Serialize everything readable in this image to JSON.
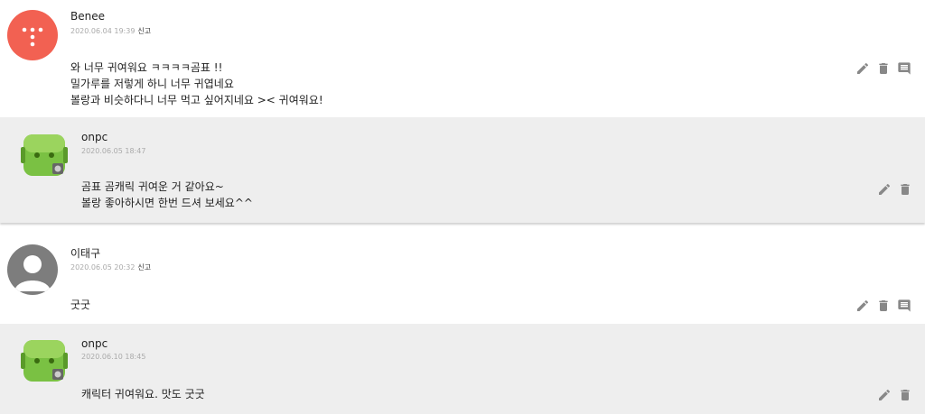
{
  "comments": [
    {
      "author": "Benee",
      "date": "2020.06.04 19:39",
      "report": "신고",
      "lines": [
        "와 너무 귀여워요 ㅋㅋㅋㅋ곰표 !!",
        "밀가루를 저렇게 하니 너무 귀엽네요",
        "볼랑과 비슷하다니 너무 먹고 싶어지네요 >< 귀여워요!"
      ],
      "avatar": "brand-logo-avatar",
      "avatar_color": "#f26152"
    },
    {
      "author": "onpc",
      "date": "2020.06.05 18:47",
      "lines": [
        "곰표 곰캐릭 귀여운 거 같아요~",
        "볼랑 좋아하시면 한번 드셔 보세요^^"
      ],
      "avatar": "android-robot-avatar",
      "avatar_color": "#7ac143"
    },
    {
      "author": "이태구",
      "date": "2020.06.05 20:32",
      "report": "신고",
      "lines": [
        "굿굿"
      ],
      "avatar": "default-user-avatar",
      "avatar_color": "#7d7d7d"
    },
    {
      "author": "onpc",
      "date": "2020.06.10 18:45",
      "lines": [
        "캐릭터 귀여워요. 맛도 굿굿"
      ],
      "avatar": "android-robot-avatar",
      "avatar_color": "#7ac143"
    }
  ],
  "icons": {
    "edit": "pencil-icon",
    "delete": "trash-icon",
    "reply": "comment-icon"
  }
}
